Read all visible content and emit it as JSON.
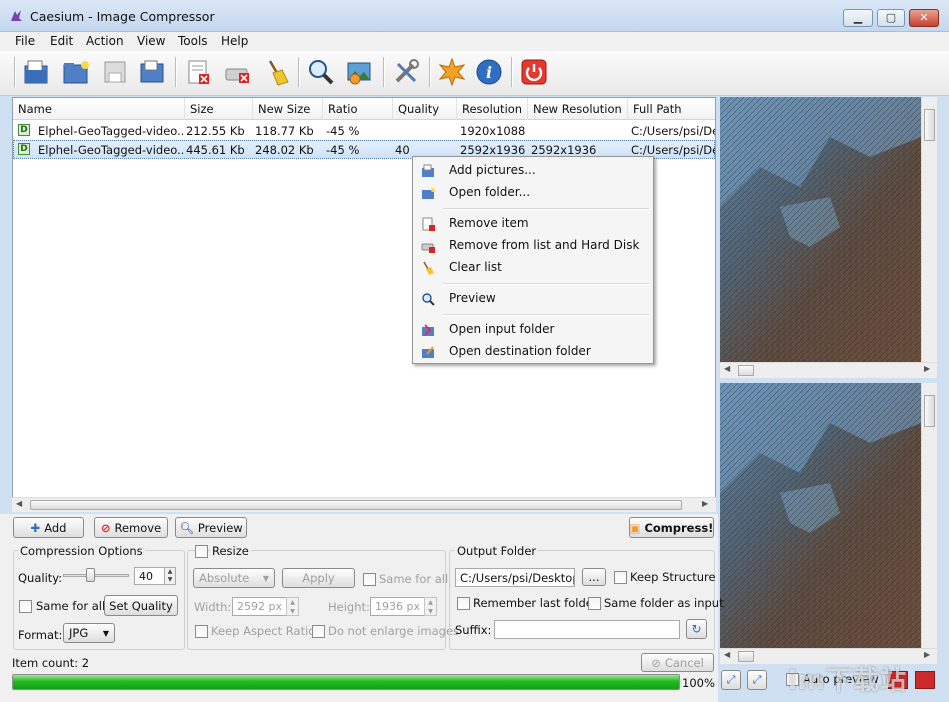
{
  "window": {
    "title": "Caesium - Image Compressor"
  },
  "menu": [
    "File",
    "Edit",
    "Action",
    "View",
    "Tools",
    "Help"
  ],
  "table": {
    "columns": [
      "Name",
      "Size",
      "New Size",
      "Ratio",
      "Quality",
      "Resolution",
      "New Resolution",
      "Full Path"
    ],
    "rows": [
      {
        "badge": "D",
        "name": "Elphel-GeoTagged-video...",
        "size": "212.55 Kb",
        "new_size": "118.77 Kb",
        "ratio": "-45 %",
        "quality": "",
        "resolution": "1920x1088",
        "new_resolution": "",
        "full_path": "C:/Users/psi/De"
      },
      {
        "badge": "D",
        "name": "Elphel-GeoTagged-video...",
        "size": "445.61 Kb",
        "new_size": "248.02 Kb",
        "ratio": "-45 %",
        "quality": "40",
        "resolution": "2592x1936",
        "new_resolution": "2592x1936",
        "full_path": "C:/Users/psi/De"
      }
    ]
  },
  "context_menu": {
    "add_pictures": "Add pictures...",
    "open_folder": "Open folder...",
    "remove_item": "Remove item",
    "remove_hd": "Remove from list and Hard Disk",
    "clear_list": "Clear list",
    "preview": "Preview",
    "open_input": "Open input folder",
    "open_dest": "Open destination folder"
  },
  "buttons": {
    "add": "Add",
    "remove": "Remove",
    "preview": "Preview",
    "compress": "Compress!"
  },
  "compression": {
    "title": "Compression Options",
    "quality_label": "Quality:",
    "quality_value": "40",
    "quality_slider_fraction": 0.4,
    "same_for_all": "Same for all",
    "set_quality": "Set Quality",
    "format_label": "Format:",
    "format_value": "JPG"
  },
  "resize": {
    "title": "Resize",
    "mode": "Absolute",
    "apply": "Apply",
    "same_for_all": "Same for all",
    "width_label": "Width:",
    "width_value": "2592 px",
    "height_label": "Height:",
    "height_value": "1936 px",
    "keep_aspect": "Keep Aspect Ratio",
    "no_enlarge": "Do not enlarge images"
  },
  "output": {
    "title": "Output Folder",
    "path": "C:/Users/psi/Desktop",
    "browse": "...",
    "keep_structure": "Keep Structure",
    "remember_last": "Remember last folder",
    "same_as_input": "Same folder as input",
    "suffix_label": "Suffix:",
    "suffix_value": ""
  },
  "status": {
    "item_count": "Item count: 2",
    "cancel": "Cancel",
    "progress_percent": 100,
    "progress_label": "100%",
    "auto_preview": "Auto preview"
  },
  "watermark": "im下载站",
  "colors": {
    "accent": "#22bb22",
    "selection": "#cde2f7"
  }
}
